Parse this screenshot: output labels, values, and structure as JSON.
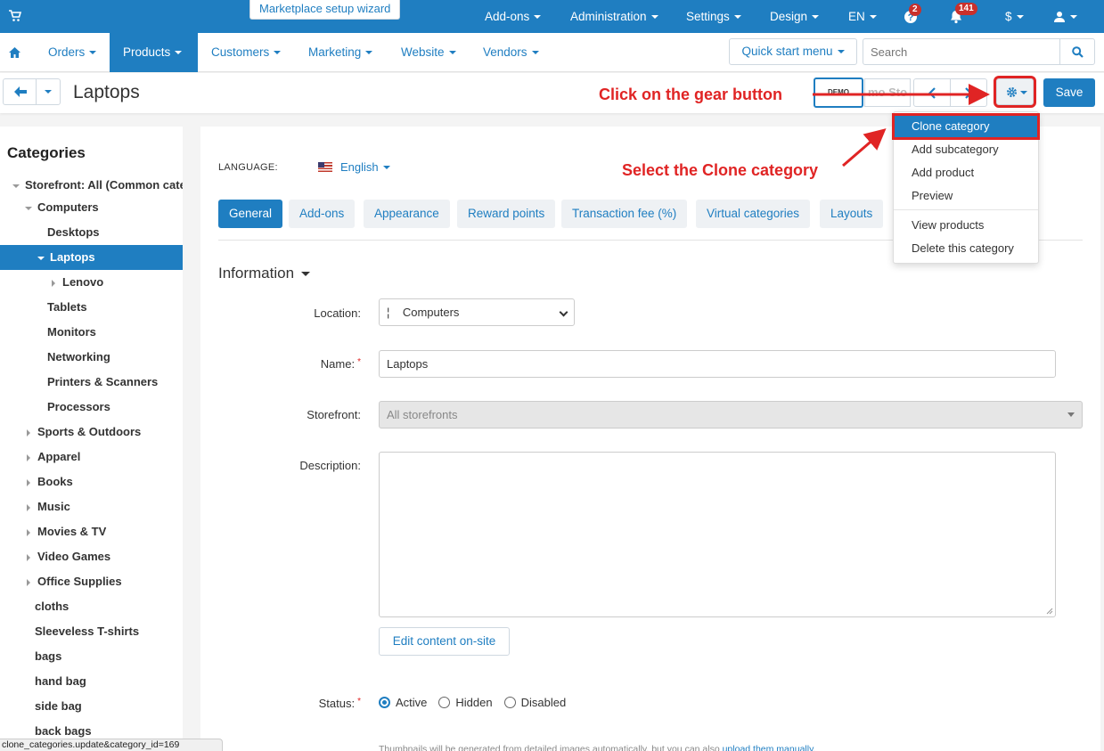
{
  "topbar": {
    "wizard": "Marketplace setup wizard",
    "items": [
      "Add-ons",
      "Administration",
      "Settings",
      "Design",
      "EN"
    ],
    "currency": "$",
    "badges": {
      "help": "2",
      "bell": "141"
    },
    "icons": {
      "cart": "cart-icon",
      "help": "help-icon",
      "bell": "bell-icon",
      "user": "user-icon"
    }
  },
  "mainnav": {
    "items": [
      "Orders",
      "Products",
      "Customers",
      "Marketing",
      "Website",
      "Vendors"
    ],
    "active": "Products",
    "quick_start": "Quick start menu",
    "search_placeholder": "Search"
  },
  "header": {
    "title": "Laptops",
    "demo_label": "DEMO STORE",
    "demo_label2": "mo Sto",
    "save": "Save",
    "annotation_gear": "Click on the gear button"
  },
  "sidebar": {
    "title": "Categories",
    "items": [
      "Storefront: All (Common categories)",
      "Computers",
      "Desktops",
      "Laptops",
      "Lenovo",
      "Tablets",
      "Monitors",
      "Networking",
      "Printers & Scanners",
      "Processors",
      "Sports & Outdoors",
      "Apparel",
      "Books",
      "Music",
      "Movies & TV",
      "Video Games",
      "Office Supplies",
      "cloths",
      "Sleeveless T-shirts",
      "bags",
      "hand bag",
      "side bag",
      "back bags"
    ]
  },
  "content": {
    "language_label": "LANGUAGE:",
    "language_value": "English",
    "annotation_clone": "Select the Clone category",
    "tabs": [
      "General",
      "Add-ons",
      "Appearance",
      "Reward points",
      "Transaction fee (%)",
      "Virtual categories",
      "Layouts"
    ],
    "section": "Information",
    "location_label": "Location:",
    "location_value": "¦    Computers",
    "name_label": "Name:",
    "name_value": "Laptops",
    "storefront_label": "Storefront:",
    "storefront_value": "All storefronts",
    "description_label": "Description:",
    "edit_btn": "Edit content on-site",
    "status_label": "Status:",
    "status_options": [
      "Active",
      "Hidden",
      "Disabled"
    ],
    "status_selected": "Active",
    "thumb_note": "Thumbnails will be generated from detailed images automatically, but you can also ",
    "thumb_link": "upload them manually."
  },
  "dropdown": {
    "items": [
      "Clone category",
      "Add subcategory",
      "Add product",
      "Preview",
      "View products",
      "Delete this category"
    ]
  },
  "statusbar": "clone_categories.update&category_id=169",
  "colors": {
    "primary": "#1f7ec1",
    "annotation": "#e02424",
    "active_bg": "#1f7ec1"
  }
}
